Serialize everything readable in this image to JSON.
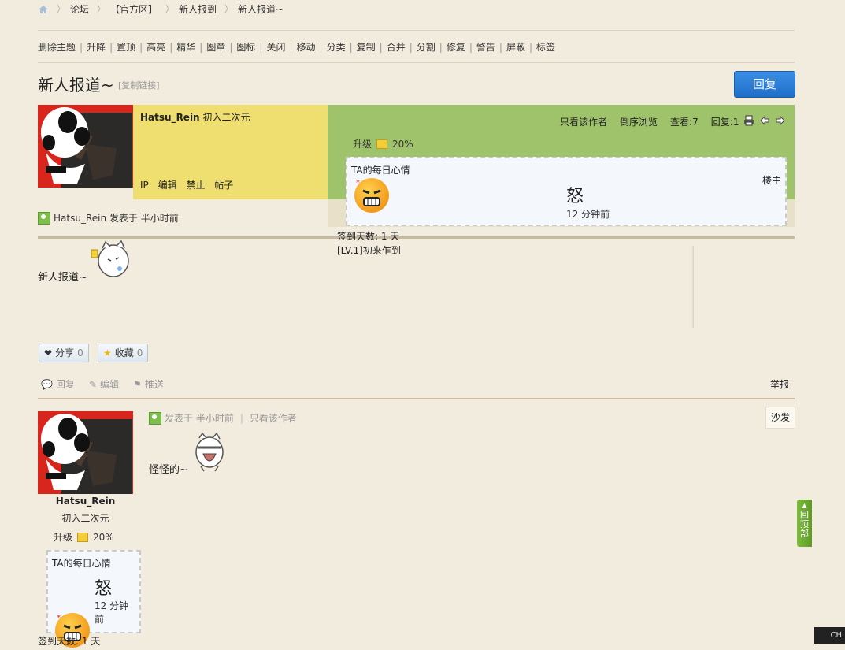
{
  "breadcrumb": [
    "论坛",
    "【官方区】",
    "新人报到",
    "新人报道~"
  ],
  "mod_toolbar": [
    "删除主题",
    "升降",
    "置顶",
    "高亮",
    "精华",
    "图章",
    "图标",
    "关闭",
    "移动",
    "分类",
    "复制",
    "合并",
    "分割",
    "修复",
    "警告",
    "屏蔽",
    "标签"
  ],
  "thread": {
    "title": "新人报道~",
    "copy_link": "[复制链接]",
    "reply_label": "回复"
  },
  "post1": {
    "author": "Hatsu_Rein",
    "rank": "初入二次元",
    "admin_links": [
      "IP",
      "编辑",
      "禁止",
      "帖子"
    ],
    "top_links": [
      "只看该作者",
      "倒序浏览",
      "查看:7",
      "回复:1"
    ],
    "upgrade_label": "升级",
    "upgrade_percent": "20%",
    "upgrade_progress": 0.2,
    "mood_title": "TA的每日心情",
    "mood_word": "怒",
    "mood_time": "12 分钟前",
    "floor_label": "楼主",
    "posted_line": "Hatsu_Rein 发表于 半小时前",
    "checkin_days": "签到天数: 1 天",
    "checkin_level": "[LV.1]初来乍到",
    "content": "新人报道~",
    "share_label": "分享",
    "share_count": "0",
    "fav_label": "收藏",
    "fav_count": "0",
    "actions": [
      "回复",
      "编辑",
      "推送"
    ],
    "report_label": "举报"
  },
  "post2": {
    "meta_posted": "发表于 半小时前",
    "meta_only_author": "只看该作者",
    "floor_label": "沙发",
    "content": "怪怪的~",
    "author": "Hatsu_Rein",
    "rank": "初入二次元",
    "upgrade_label": "升级",
    "upgrade_percent": "20%",
    "upgrade_progress": 0.2,
    "mood_title": "TA的每日心情",
    "mood_word": "怒",
    "mood_time": "12 分钟前",
    "checkin_days": "签到天数: 1 天"
  },
  "gotop_label": "回顶部",
  "ime_label": "CH",
  "colors": {
    "yellow_panel": "#efde70",
    "green_panel": "#9fc36b",
    "reply_button": "#2a80d8",
    "page_bg": "#f2ecdf"
  }
}
